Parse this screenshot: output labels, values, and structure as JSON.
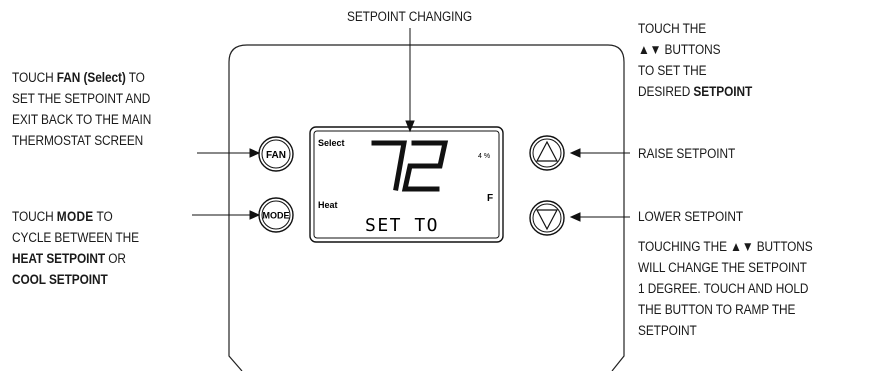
{
  "title": "SETPOINT CHANGING",
  "left_fan": {
    "l1_pre": "TOUCH ",
    "l1_bold": "FAN (Select)",
    "l1_post": " TO",
    "l2": "SET THE SETPOINT AND",
    "l3": "EXIT BACK TO THE MAIN",
    "l4": "THERMOSTAT SCREEN"
  },
  "left_mode": {
    "l1_pre": "TOUCH ",
    "l1_bold": "MODE",
    "l1_post": " TO",
    "l2": "CYCLE BETWEEN THE",
    "l3_bold": "HEAT SETPOINT",
    "l3_post": " OR",
    "l4_bold": "COOL SETPOINT"
  },
  "right_top": {
    "l1": "TOUCH THE",
    "l2": "▲▼ BUTTONS",
    "l3": "TO SET THE",
    "l4_pre": "DESIRED ",
    "l4_bold": "SETPOINT"
  },
  "raise": "RAISE SETPOINT",
  "lower": "LOWER SETPOINT",
  "note": {
    "l1": "TOUCHING THE ▲▼ BUTTONS",
    "l2": "WILL CHANGE THE SETPOINT",
    "l3": "1 DEGREE. TOUCH AND HOLD",
    "l4": "THE BUTTON TO RAMP THE",
    "l5": "SETPOINT"
  },
  "buttons": {
    "fan": "FAN",
    "mode": "MODE"
  },
  "display": {
    "select": "Select",
    "heat": "Heat",
    "value": "72",
    "unit": "F",
    "small": "4 %",
    "status": "SET TO"
  }
}
